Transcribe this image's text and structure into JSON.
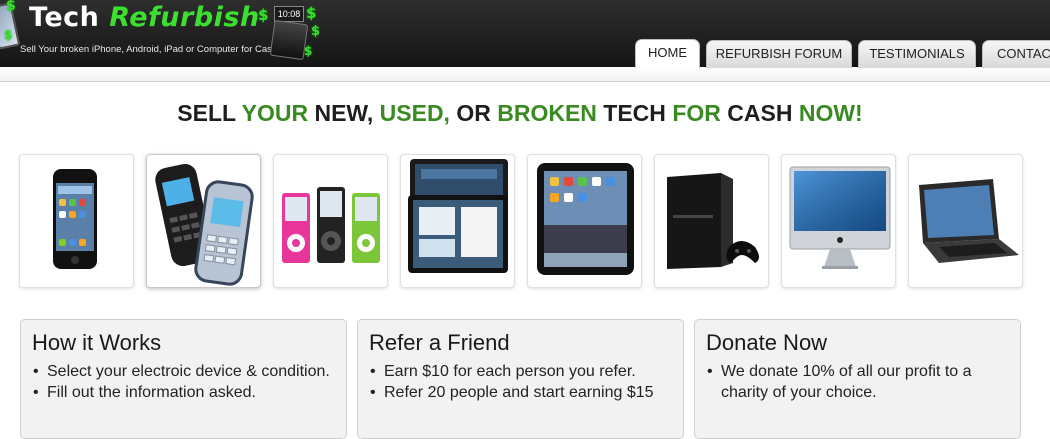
{
  "header": {
    "logo_word1": "Tech",
    "logo_word2": "Refurbish",
    "tagline": "Sell Your broken iPhone, Android, iPad or Computer for Cash!",
    "device_screen": "10:08"
  },
  "nav": [
    {
      "label": "HOME",
      "active": true
    },
    {
      "label": "REFURBISH FORUM",
      "active": false
    },
    {
      "label": "TESTIMONIALS",
      "active": false
    },
    {
      "label": "CONTACT",
      "active": false
    }
  ],
  "headline": {
    "w1": "SELL",
    "w2": "YOUR",
    "w3": "NEW,",
    "w4": "USED,",
    "w5": "OR",
    "w6": "BROKEN",
    "w7": "TECH",
    "w8": "FOR",
    "w9": "CASH",
    "w10": "NOW!"
  },
  "products": [
    {
      "icon": "iphone-icon"
    },
    {
      "icon": "nokia-phones-icon"
    },
    {
      "icon": "ipod-nano-icon"
    },
    {
      "icon": "tablets-icon"
    },
    {
      "icon": "ipad-icon"
    },
    {
      "icon": "game-console-icon"
    },
    {
      "icon": "imac-icon"
    },
    {
      "icon": "laptop-icon"
    }
  ],
  "boxes": {
    "how": {
      "title": "How it Works",
      "items": [
        "Select your electroic device & condition.",
        "Fill out the information asked."
      ]
    },
    "refer": {
      "title": "Refer a Friend",
      "items": [
        "Earn $10 for each person you refer.",
        "Refer 20 people and start earning $15"
      ]
    },
    "donate": {
      "title": "Donate Now",
      "items": [
        "We donate 10% of all our profit to a charity of your choice."
      ]
    }
  },
  "colors": {
    "accent_green": "#3a8a22",
    "logo_green": "#3ce02e",
    "header_bg": "#1c1c1c"
  }
}
